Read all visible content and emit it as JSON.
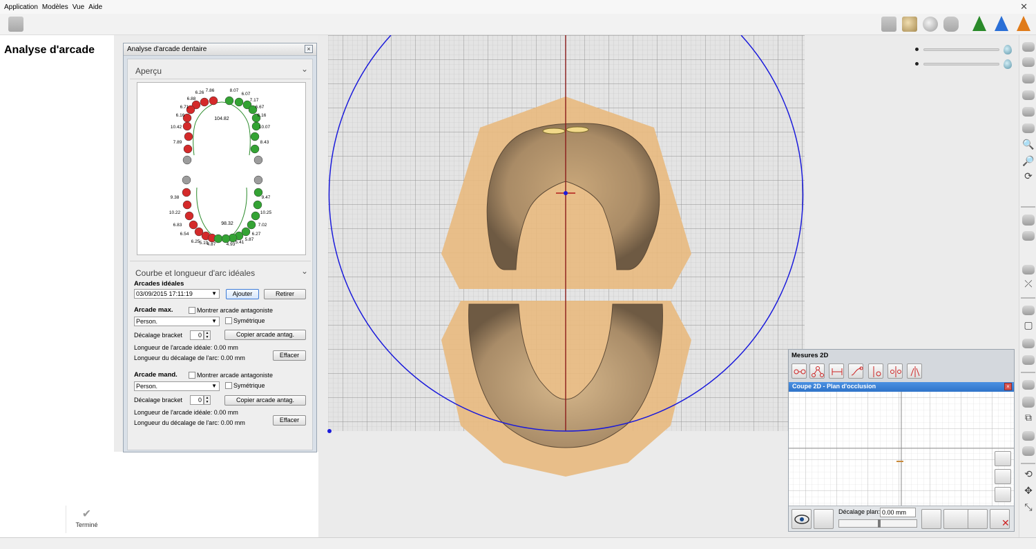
{
  "menu": {
    "items": [
      "Application",
      "Modèles",
      "Vue",
      "Aide"
    ]
  },
  "left_panel": {
    "title": "Analyse d'arcade",
    "done_label": "Terminé"
  },
  "dialog": {
    "title": "Analyse d'arcade dentaire",
    "overview": {
      "header": "Aperçu",
      "upper_length": "104.82",
      "lower_length": "98.32",
      "upper_labels": [
        "6.26",
        "7.86",
        "8.07",
        "6.07",
        "6.88",
        "7.17",
        "6.71",
        "6.67",
        "6.16",
        "6.16",
        "10.42",
        "10.07",
        "7.89",
        "8.43"
      ],
      "lower_labels": [
        "9.38",
        "9.47",
        "10.22",
        "10.25",
        "6.83",
        "7.02",
        "6.54",
        "6.27",
        "6.25",
        "5.87",
        "5.19",
        "4.87",
        "4.93",
        "5.41"
      ]
    },
    "curve_section": {
      "header": "Courbe et longueur d'arc idéales",
      "ideal_arches_label": "Arcades idéales",
      "ideal_arches_value": "03/09/2015  17:11:19",
      "add_button": "Ajouter",
      "remove_button": "Retirer",
      "max": {
        "label": "Arcade max.",
        "show_antag": "Montrer arcade antagoniste",
        "combo_value": "Person.",
        "symmetric": "Symétrique",
        "offset_label": "Décalage bracket",
        "offset_value": "0",
        "copy_button": "Copier arcade antag.",
        "ideal_length": "Longueur de l'arcade idéale: 0.00 mm",
        "offset_length": "Longueur du décalage de l'arc: 0.00 mm",
        "clear_button": "Effacer"
      },
      "mand": {
        "label": "Arcade mand.",
        "show_antag": "Montrer arcade antagoniste",
        "combo_value": "Person.",
        "symmetric": "Symétrique",
        "offset_label": "Décalage bracket",
        "offset_value": "0",
        "copy_button": "Copier arcade antag.",
        "ideal_length": "Longueur de l'arcade idéale: 0.00 mm",
        "offset_length": "Longueur du décalage de l'arc: 0.00 mm",
        "clear_button": "Effacer"
      }
    }
  },
  "mesures": {
    "title": "Mesures 2D",
    "coupe_title": "Coupe 2D - Plan d'occlusion",
    "offset_label": "Décalage plan:",
    "offset_value": "0.00 mm"
  },
  "colors": {
    "arch_circle": "#1a1adb",
    "midline": "#8b1a1a",
    "model": "#e8b97e",
    "tooth_red": "#d42a2a",
    "tooth_green": "#34a334",
    "tooth_grey": "#9c9c9c"
  }
}
